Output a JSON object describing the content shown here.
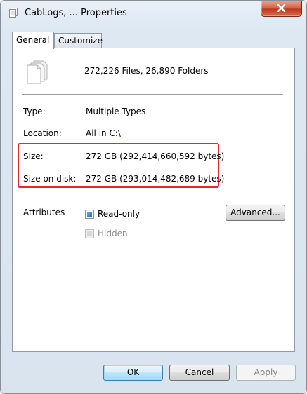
{
  "window": {
    "title": "CabLogs, ... Properties"
  },
  "tabs": [
    {
      "label": "General",
      "active": true
    },
    {
      "label": "Customize",
      "active": false
    }
  ],
  "general": {
    "summary": "272,226 Files, 26,890 Folders",
    "type_label": "Type:",
    "type_value": "Multiple Types",
    "location_label": "Location:",
    "location_value": "All in C:\\",
    "size_label": "Size:",
    "size_value": "272 GB (292,414,660,592 bytes)",
    "size_on_disk_label": "Size on disk:",
    "size_on_disk_value": "272 GB (293,014,482,689 bytes)",
    "attributes_label": "Attributes",
    "readonly_label": "Read-only",
    "readonly_state": "indeterminate",
    "hidden_label": "Hidden",
    "hidden_state": "disabled",
    "advanced_label": "Advanced..."
  },
  "footer": {
    "ok_label": "OK",
    "cancel_label": "Cancel",
    "apply_label": "Apply"
  },
  "colors": {
    "highlight_border": "#e8262d",
    "close_button": "#c0391f",
    "checkbox_fill": "#1f70b4"
  }
}
